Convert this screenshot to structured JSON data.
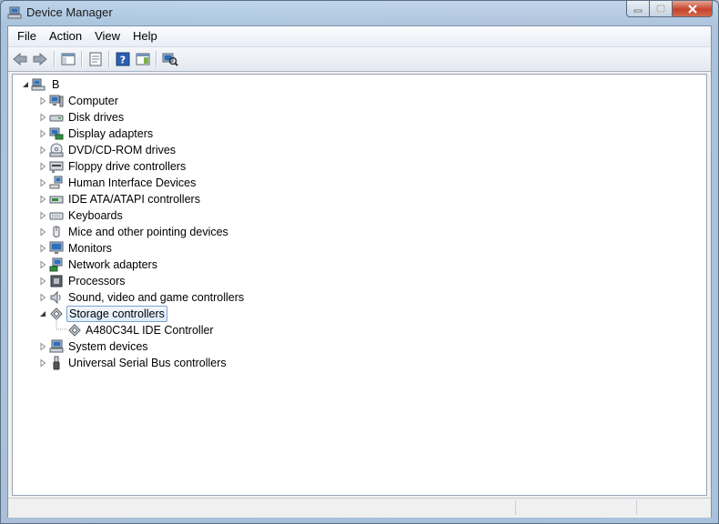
{
  "window": {
    "title": "Device Manager"
  },
  "menu": [
    "File",
    "Action",
    "View",
    "Help"
  ],
  "toolbar": [
    "back-icon",
    "forward-icon",
    "show-hide-console-tree-icon",
    "properties-icon",
    "help-icon",
    "show-action-pane-icon",
    "scan-hardware-icon"
  ],
  "tree": {
    "root": "B",
    "categories": [
      {
        "label": "Computer",
        "icon": "computer-icon",
        "expanded": false
      },
      {
        "label": "Disk drives",
        "icon": "disk-drive-icon",
        "expanded": false
      },
      {
        "label": "Display adapters",
        "icon": "display-adapter-icon",
        "expanded": false
      },
      {
        "label": "DVD/CD-ROM drives",
        "icon": "dvd-drive-icon",
        "expanded": false
      },
      {
        "label": "Floppy drive controllers",
        "icon": "floppy-controller-icon",
        "expanded": false
      },
      {
        "label": "Human Interface Devices",
        "icon": "hid-icon",
        "expanded": false
      },
      {
        "label": "IDE ATA/ATAPI controllers",
        "icon": "ide-controller-icon",
        "expanded": false
      },
      {
        "label": "Keyboards",
        "icon": "keyboard-icon",
        "expanded": false
      },
      {
        "label": "Mice and other pointing devices",
        "icon": "mouse-icon",
        "expanded": false
      },
      {
        "label": "Monitors",
        "icon": "monitor-icon",
        "expanded": false
      },
      {
        "label": "Network adapters",
        "icon": "network-adapter-icon",
        "expanded": false
      },
      {
        "label": "Processors",
        "icon": "processor-icon",
        "expanded": false
      },
      {
        "label": "Sound, video and game controllers",
        "icon": "sound-icon",
        "expanded": false
      },
      {
        "label": "Storage controllers",
        "icon": "storage-controller-icon",
        "expanded": true,
        "selected": true,
        "children": [
          {
            "label": "A480C34L IDE Controller",
            "icon": "storage-controller-icon"
          }
        ]
      },
      {
        "label": "System devices",
        "icon": "system-devices-icon",
        "expanded": false
      },
      {
        "label": "Universal Serial Bus controllers",
        "icon": "usb-icon",
        "expanded": false
      }
    ]
  },
  "colors": {
    "selection_border": "#7da2ce",
    "selection_fill": "#dcebfb",
    "close_button": "#c7432a"
  }
}
